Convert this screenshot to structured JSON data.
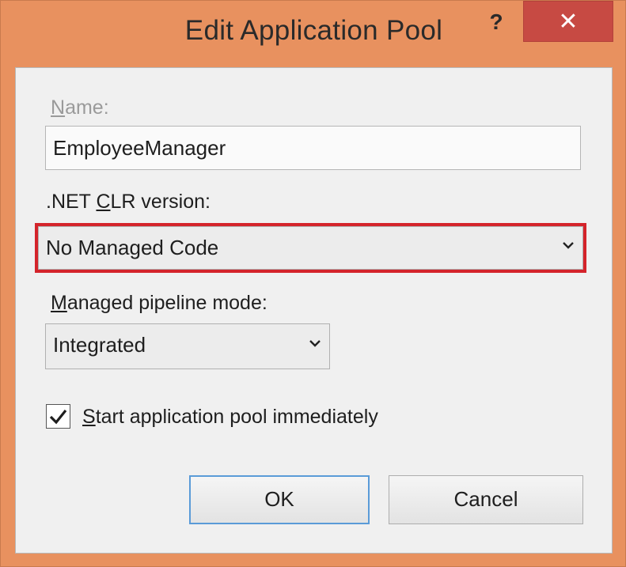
{
  "window": {
    "title": "Edit Application Pool",
    "help_label": "?",
    "close_label": "✕"
  },
  "form": {
    "name_label_first": "N",
    "name_label_rest": "ame:",
    "name_value": "EmployeeManager",
    "clr_label_pre": ".NET ",
    "clr_label_accel": "C",
    "clr_label_post": "LR version:",
    "clr_selected": "No Managed Code",
    "pipeline_label_first": "M",
    "pipeline_label_rest": "anaged pipeline mode:",
    "pipeline_selected": "Integrated",
    "start_checked": true,
    "start_label_first": "S",
    "start_label_rest": "tart application pool immediately"
  },
  "buttons": {
    "ok_label": "OK",
    "cancel_label": "Cancel"
  },
  "colors": {
    "frame": "#e8915f",
    "close_button": "#c74a43",
    "highlight": "#d4242b",
    "default_button_border": "#5a9bd8"
  }
}
